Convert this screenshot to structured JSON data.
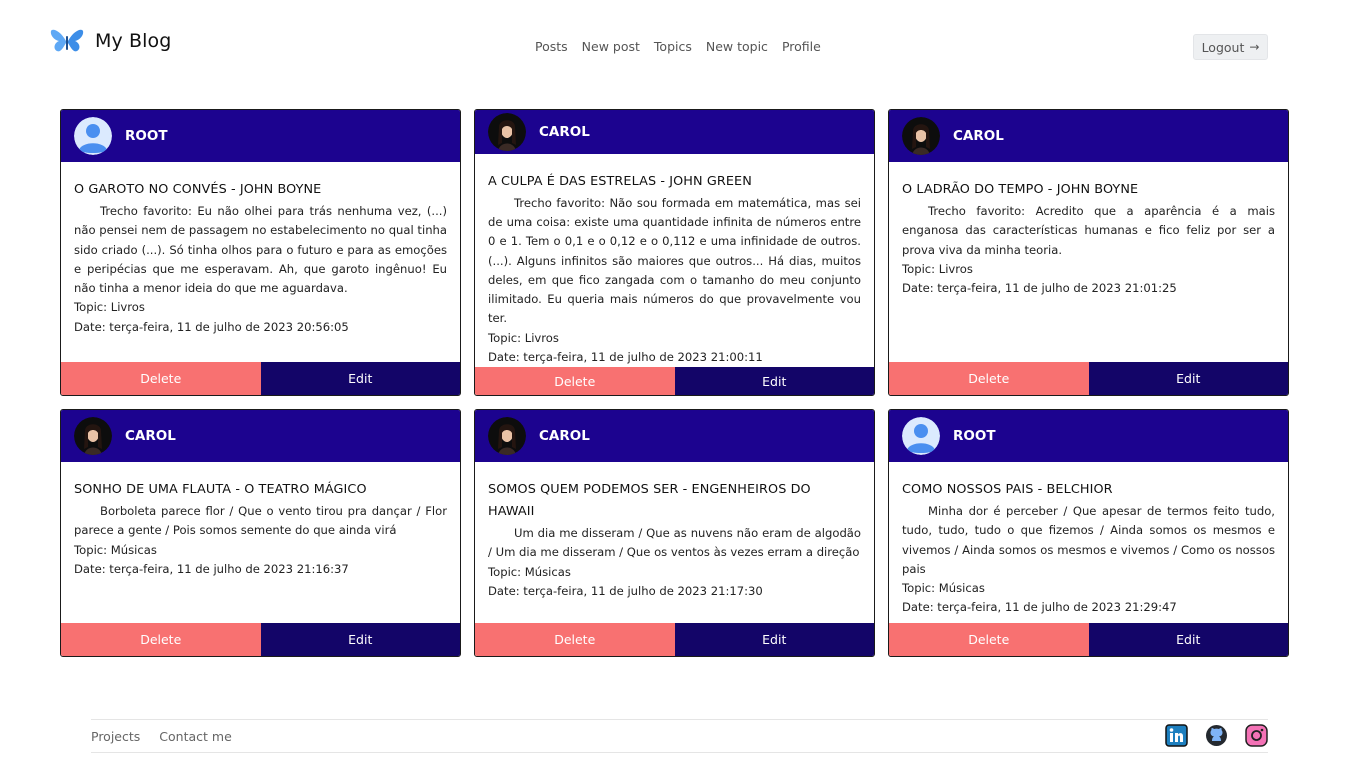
{
  "header": {
    "brand": "My Blog",
    "nav": [
      "Posts",
      "New post",
      "Topics",
      "New topic",
      "Profile"
    ],
    "logout_label": "Logout",
    "logout_icon": "arrow-right-icon"
  },
  "posts": [
    {
      "author": "ROOT",
      "avatar": "default-user",
      "title": "O GAROTO NO CONVÉS - JOHN BOYNE",
      "text": "Trecho favorito: Eu não olhei para trás nenhuma vez, (...) não pensei nem de passagem no estabelecimento no qual tinha sido criado (...). Só tinha olhos para o futuro e para as emoções e peripécias que me esperavam. Ah, que garoto ingênuo! Eu não tinha a menor ideia do que me aguardava.",
      "topic": "Topic: Livros",
      "date": "Date: terça-feira, 11 de julho de 2023 20:56:05",
      "delete_label": "Delete",
      "edit_label": "Edit"
    },
    {
      "author": "CAROL",
      "avatar": "photo",
      "title": "A CULPA É DAS ESTRELAS - JOHN GREEN",
      "text": "Trecho favorito: Não sou formada em matemática, mas sei de uma coisa: existe uma quantidade infinita de números entre 0 e 1. Tem o 0,1 e o 0,12 e o 0,112 e uma infinidade de outros. (...). Alguns infinitos são maiores que outros... Há dias, muitos deles, em que fico zangada com o tamanho do meu conjunto ilimitado. Eu queria mais números do que provavelmente vou ter.",
      "topic": "Topic: Livros",
      "date": "Date: terça-feira, 11 de julho de 2023 21:00:11",
      "delete_label": "Delete",
      "edit_label": "Edit"
    },
    {
      "author": "CAROL",
      "avatar": "photo",
      "title": "O LADRÃO DO TEMPO - JOHN BOYNE",
      "text": "Trecho favorito: Acredito que a aparência é a mais enganosa das características humanas e fico feliz por ser a prova viva da minha teoria.",
      "topic": "Topic: Livros",
      "date": "Date: terça-feira, 11 de julho de 2023 21:01:25",
      "delete_label": "Delete",
      "edit_label": "Edit"
    },
    {
      "author": "CAROL",
      "avatar": "photo",
      "title": "SONHO DE UMA FLAUTA - O TEATRO MÁGICO",
      "text": "Borboleta parece flor / Que o vento tirou pra dançar / Flor parece a gente / Pois somos semente do que ainda virá",
      "topic": "Topic: Músicas",
      "date": "Date: terça-feira, 11 de julho de 2023 21:16:37",
      "delete_label": "Delete",
      "edit_label": "Edit"
    },
    {
      "author": "CAROL",
      "avatar": "photo",
      "title": "SOMOS QUEM PODEMOS SER - ENGENHEIROS DO HAWAII",
      "text": "Um dia me disseram / Que as nuvens não eram de algodão / Um dia me disseram / Que os ventos às vezes erram a direção",
      "topic": "Topic: Músicas",
      "date": "Date: terça-feira, 11 de julho de 2023 21:17:30",
      "delete_label": "Delete",
      "edit_label": "Edit"
    },
    {
      "author": "ROOT",
      "avatar": "default-user",
      "title": "COMO NOSSOS PAIS - BELCHIOR",
      "text": "Minha dor é perceber / Que apesar de termos feito tudo, tudo, tudo, tudo o que fizemos / Ainda somos os mesmos e vivemos / Ainda somos os mesmos e vivemos / Como os nossos pais",
      "topic": "Topic: Músicas",
      "date": "Date: terça-feira, 11 de julho de 2023 21:29:47",
      "delete_label": "Delete",
      "edit_label": "Edit"
    }
  ],
  "footer": {
    "links": [
      "Projects",
      "Contact me"
    ],
    "social_icons": [
      "linkedin-icon",
      "github-icon",
      "instagram-icon"
    ]
  },
  "colors": {
    "card_header": "#1c038f",
    "delete_button": "#f87171",
    "edit_button": "#130568"
  }
}
